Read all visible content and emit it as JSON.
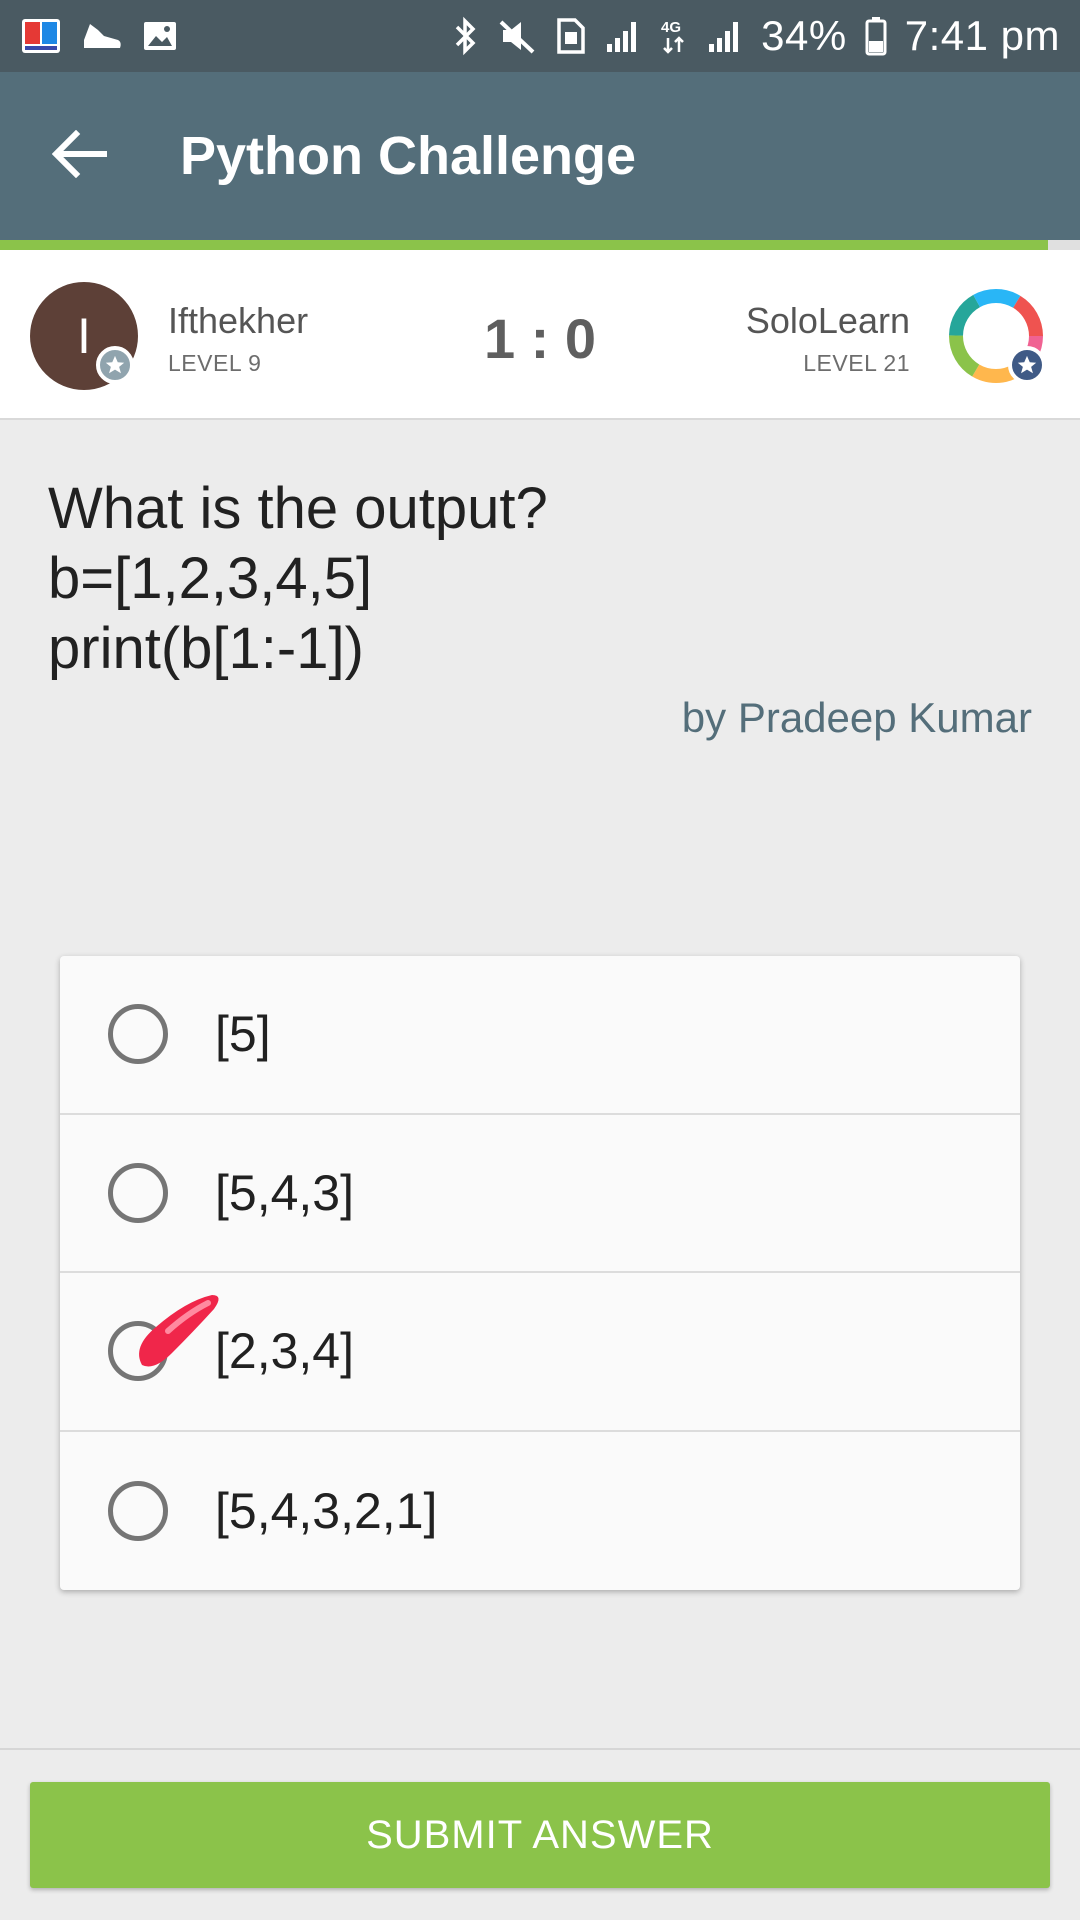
{
  "status_bar": {
    "battery": "34%",
    "time": "7:41 pm",
    "left_icons": [
      "dictionary-app-icon",
      "shoe-icon",
      "image-icon"
    ],
    "right_icons": [
      "bluetooth-icon",
      "mute-icon",
      "sim-icon",
      "signal-icon",
      "4g-icon",
      "signal-icon",
      "battery-icon"
    ]
  },
  "app_bar": {
    "title": "Python Challenge",
    "back_icon": "arrow-back-icon"
  },
  "progress": {
    "fraction": 0.97,
    "color": "#8bc34a"
  },
  "players": {
    "left": {
      "initial": "I",
      "name": "Ifthekher",
      "level": "LEVEL 9",
      "avatar_color": "#5d4037"
    },
    "right": {
      "name": "SoloLearn",
      "level": "LEVEL 21"
    },
    "score": "1 : 0"
  },
  "question": {
    "lines": [
      "What is the output?",
      "b=[1,2,3,4,5]",
      "print(b[1:-1])"
    ],
    "author": "by Pradeep Kumar"
  },
  "answers": [
    {
      "text": "[5]",
      "selected": false
    },
    {
      "text": "[5,4,3]",
      "selected": false
    },
    {
      "text": "[2,3,4]",
      "selected": true
    },
    {
      "text": "[5,4,3,2,1]",
      "selected": false
    }
  ],
  "submit": {
    "label": "SUBMIT ANSWER"
  },
  "colors": {
    "status_bar": "#4a5a62",
    "app_bar": "#546e7a",
    "accent_green": "#8bc34a",
    "author": "#546e7a"
  }
}
